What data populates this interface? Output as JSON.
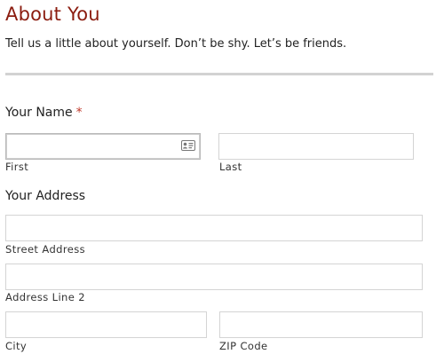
{
  "header": {
    "title": "About You",
    "subtitle": "Tell us a little about yourself. Don’t be shy. Let’s be friends."
  },
  "name_section": {
    "label": "Your Name",
    "required_marker": "*",
    "first": {
      "value": "",
      "placeholder": "",
      "sub_label": "First"
    },
    "last": {
      "value": "",
      "placeholder": "",
      "sub_label": "Last"
    },
    "autofill_icon": "contact-card-icon"
  },
  "address_section": {
    "label": "Your Address",
    "street": {
      "value": "",
      "placeholder": "",
      "sub_label": "Street Address"
    },
    "line2": {
      "value": "",
      "placeholder": "",
      "sub_label": "Address Line 2"
    },
    "city": {
      "value": "",
      "placeholder": "",
      "sub_label": "City"
    },
    "zip": {
      "value": "",
      "placeholder": "",
      "sub_label": "ZIP Code"
    }
  },
  "colors": {
    "title": "#8b1c0f",
    "required": "#c0392b",
    "divider": "#d2d2d2",
    "input_border": "#d4d4d4"
  }
}
